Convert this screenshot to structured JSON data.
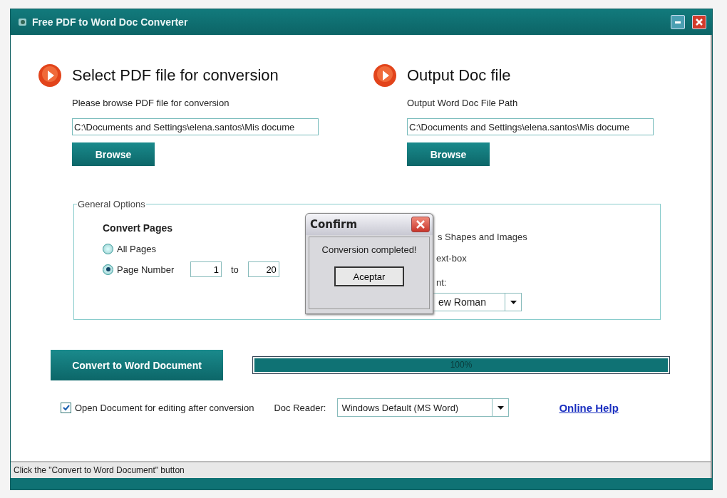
{
  "window": {
    "title": "Free PDF to Word Doc Converter"
  },
  "sections": [
    {
      "heading": "Select PDF file for conversion",
      "prompt": "Please browse PDF file for conversion",
      "path": "C:\\Documents and Settings\\elena.santos\\Mis docume",
      "button": "Browse"
    },
    {
      "heading": "Output Doc file",
      "prompt": "Output Word Doc File Path",
      "path": "C:\\Documents and Settings\\elena.santos\\Mis docume",
      "button": "Browse"
    }
  ],
  "general_options": {
    "legend": "General Options",
    "convert_pages": {
      "title": "Convert Pages",
      "options": [
        {
          "label": "All Pages",
          "selected": false
        },
        {
          "label": "Page Number",
          "selected": true
        }
      ],
      "from": "1",
      "to_label": "to",
      "to": "20"
    },
    "partial": {
      "shapes_label": "s Shapes and Images",
      "textbox_label": "ext-box",
      "font_label": "nt:",
      "font_value": "ew Roman"
    }
  },
  "convert_button": "Convert to Word Document",
  "progress": {
    "level": 1,
    "reading": "100%"
  },
  "open_after": {
    "label": "Open Document for editing after conversion",
    "checked": true
  },
  "doc_reader": {
    "label": "Doc Reader:",
    "value": "Windows Default (MS Word)"
  },
  "online_help": "Online Help",
  "status_bar": "Click the \"Convert to Word Document\" button",
  "dialog": {
    "title": "Confirm",
    "message": "Conversion completed!",
    "button": "Aceptar"
  }
}
